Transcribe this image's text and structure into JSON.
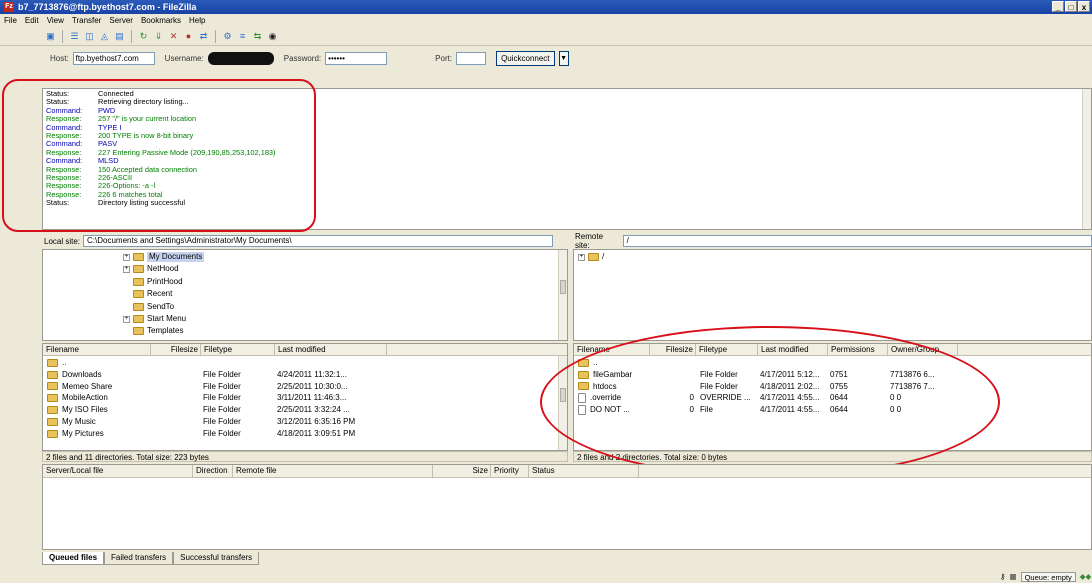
{
  "window": {
    "title": "b7_7713876@ftp.byethost7.com - FileZilla",
    "app_icon": "Fz",
    "buttons": [
      "_",
      "□",
      "x"
    ]
  },
  "menu": [
    "File",
    "Edit",
    "View",
    "Transfer",
    "Server",
    "Bookmarks",
    "Help"
  ],
  "toolbar_icons": [
    "site-manager-icon",
    "toggle-log-icon",
    "toggle-local-tree-icon",
    "toggle-remote-tree-icon",
    "toggle-queue-icon",
    "refresh-icon",
    "process-queue-icon",
    "cancel-icon",
    "disconnect-icon",
    "reconnect-icon",
    "filter-icon",
    "compare-icon",
    "sync-browse-icon",
    "search-icon"
  ],
  "quickconnect": {
    "host_label": "Host:",
    "host_value": "ftp.byethost7.com",
    "username_label": "Username:",
    "password_label": "Password:",
    "password_value": "••••••",
    "port_label": "Port:",
    "port_value": "",
    "button": "Quickconnect"
  },
  "log": [
    {
      "k": "Status:",
      "v": "Connected",
      "type": "status"
    },
    {
      "k": "Status:",
      "v": "Retrieving directory listing...",
      "type": "status"
    },
    {
      "k": "Command:",
      "v": "PWD",
      "type": "command"
    },
    {
      "k": "Response:",
      "v": "257 \"/\" is your current location",
      "type": "response"
    },
    {
      "k": "Command:",
      "v": "TYPE I",
      "type": "command"
    },
    {
      "k": "Response:",
      "v": "200 TYPE is now 8-bit binary",
      "type": "response"
    },
    {
      "k": "Command:",
      "v": "PASV",
      "type": "command"
    },
    {
      "k": "Response:",
      "v": "227 Entering Passive Mode (209,190,85,253,102,183)",
      "type": "response"
    },
    {
      "k": "Command:",
      "v": "MLSD",
      "type": "command"
    },
    {
      "k": "Response:",
      "v": "150 Accepted data connection",
      "type": "response"
    },
    {
      "k": "Response:",
      "v": "226-ASCII",
      "type": "response"
    },
    {
      "k": "Response:",
      "v": "226-Options: -a -l",
      "type": "response"
    },
    {
      "k": "Response:",
      "v": "226 6 matches total",
      "type": "response"
    },
    {
      "k": "Status:",
      "v": "Directory listing successful",
      "type": "status"
    }
  ],
  "local": {
    "site_label": "Local site:",
    "site_path": "C:\\Documents and Settings\\Administrator\\My Documents\\",
    "tree": [
      {
        "label": "My Documents",
        "expander": "+",
        "selected": true
      },
      {
        "label": "NetHood",
        "expander": "+",
        "selected": false
      },
      {
        "label": "PrintHood",
        "expander": "",
        "selected": false
      },
      {
        "label": "Recent",
        "expander": "",
        "selected": false
      },
      {
        "label": "SendTo",
        "expander": "",
        "selected": false
      },
      {
        "label": "Start Menu",
        "expander": "+",
        "selected": false
      },
      {
        "label": "Templates",
        "expander": "",
        "selected": false
      }
    ],
    "columns": [
      "Filename",
      "Filesize",
      "Filetype",
      "Last modified"
    ],
    "rows": [
      {
        "name": "..",
        "size": "",
        "type": "",
        "modified": ""
      },
      {
        "name": "Downloads",
        "size": "",
        "type": "File Folder",
        "modified": "4/24/2011 11:32:1..."
      },
      {
        "name": "Memeo Share",
        "size": "",
        "type": "File Folder",
        "modified": "2/25/2011 10:30:0..."
      },
      {
        "name": "MobileAction",
        "size": "",
        "type": "File Folder",
        "modified": "3/11/2011 11:46:3..."
      },
      {
        "name": "My ISO Files",
        "size": "",
        "type": "File Folder",
        "modified": "2/25/2011 3:32:24 ..."
      },
      {
        "name": "My Music",
        "size": "",
        "type": "File Folder",
        "modified": "3/12/2011 6:35:16 PM"
      },
      {
        "name": "My Pictures",
        "size": "",
        "type": "File Folder",
        "modified": "4/18/2011 3:09:51 PM"
      }
    ],
    "status": "2 files and 11 directories. Total size: 223 bytes"
  },
  "remote": {
    "site_label": "Remote site:",
    "site_path": "/",
    "tree_root": "/",
    "columns": [
      "Filename",
      "Filesize",
      "Filetype",
      "Last modified",
      "Permissions",
      "Owner/Group"
    ],
    "rows": [
      {
        "name": "..",
        "size": "",
        "type": "",
        "modified": "",
        "perm": "",
        "owner": ""
      },
      {
        "name": "fileGambar",
        "size": "",
        "type": "File Folder",
        "modified": "4/17/2011 5:12...",
        "perm": "0751",
        "owner": "7713876 6..."
      },
      {
        "name": "htdocs",
        "size": "",
        "type": "File Folder",
        "modified": "4/18/2011 2:02...",
        "perm": "0755",
        "owner": "7713876 7..."
      },
      {
        "name": ".override",
        "size": "0",
        "type": "OVERRIDE ...",
        "modified": "4/17/2011 4:55...",
        "perm": "0644",
        "owner": "0 0"
      },
      {
        "name": "DO NOT ...",
        "size": "0",
        "type": "File",
        "modified": "4/17/2011 4:55...",
        "perm": "0644",
        "owner": "0 0"
      }
    ],
    "status": "2 files and 2 directories. Total size: 0 bytes"
  },
  "queue": {
    "columns": [
      "Server/Local file",
      "Direction",
      "Remote file",
      "Size",
      "Priority",
      "Status"
    ],
    "tabs": [
      "Queued files",
      "Failed transfers",
      "Successful transfers"
    ]
  },
  "statusbar": {
    "queue_text": "Queue: empty"
  },
  "colors": {
    "annotation": "#d8101a",
    "title_bar": "#1941a5",
    "log_command": "#0000b0",
    "log_response": "#008000"
  }
}
